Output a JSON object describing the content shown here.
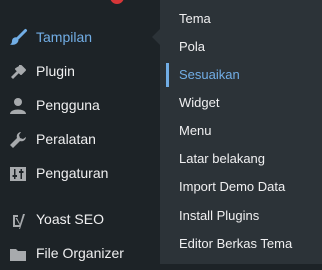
{
  "colors": {
    "sidebar_bg": "#1d2327",
    "submenu_bg": "#2c3338",
    "text": "#f0f0f1",
    "accent": "#72aee6",
    "icon": "#a7aaad",
    "notification": "#d63638"
  },
  "sidebar": {
    "items": [
      {
        "label": "Tampilan",
        "icon": "paintbrush-icon",
        "active": true
      },
      {
        "label": "Plugin",
        "icon": "plug-icon"
      },
      {
        "label": "Pengguna",
        "icon": "user-icon"
      },
      {
        "label": "Peralatan",
        "icon": "wrench-icon"
      },
      {
        "label": "Pengaturan",
        "icon": "sliders-icon"
      },
      {
        "label": "Yoast SEO",
        "icon": "yoast-icon"
      },
      {
        "label": "File Organizer",
        "icon": "folder-icon"
      }
    ]
  },
  "submenu": {
    "items": [
      {
        "label": "Tema"
      },
      {
        "label": "Pola"
      },
      {
        "label": "Sesuaikan",
        "current": true
      },
      {
        "label": "Widget"
      },
      {
        "label": "Menu"
      },
      {
        "label": "Latar belakang"
      },
      {
        "label": "Import Demo Data"
      },
      {
        "label": "Install Plugins"
      },
      {
        "label": "Editor Berkas Tema"
      }
    ]
  }
}
